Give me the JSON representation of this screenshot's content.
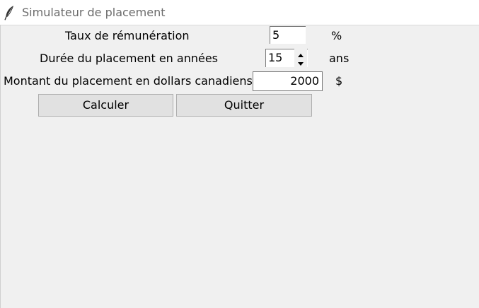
{
  "window": {
    "title": "Simulateur de placement",
    "icon": "feather-icon"
  },
  "form": {
    "taux": {
      "label": "Taux de rémunération",
      "value": "5",
      "unit": "%"
    },
    "duree": {
      "label": "Durée du placement en années",
      "value": "15",
      "unit": "ans"
    },
    "montant": {
      "label": "Montant du placement en dollars canadiens",
      "value": "2000",
      "unit": "$"
    }
  },
  "buttons": {
    "calculer": "Calculer",
    "quitter": "Quitter"
  },
  "colors": {
    "background": "#f0f0f0",
    "button_face": "#e1e1e1",
    "entry_background": "#ffffff"
  }
}
